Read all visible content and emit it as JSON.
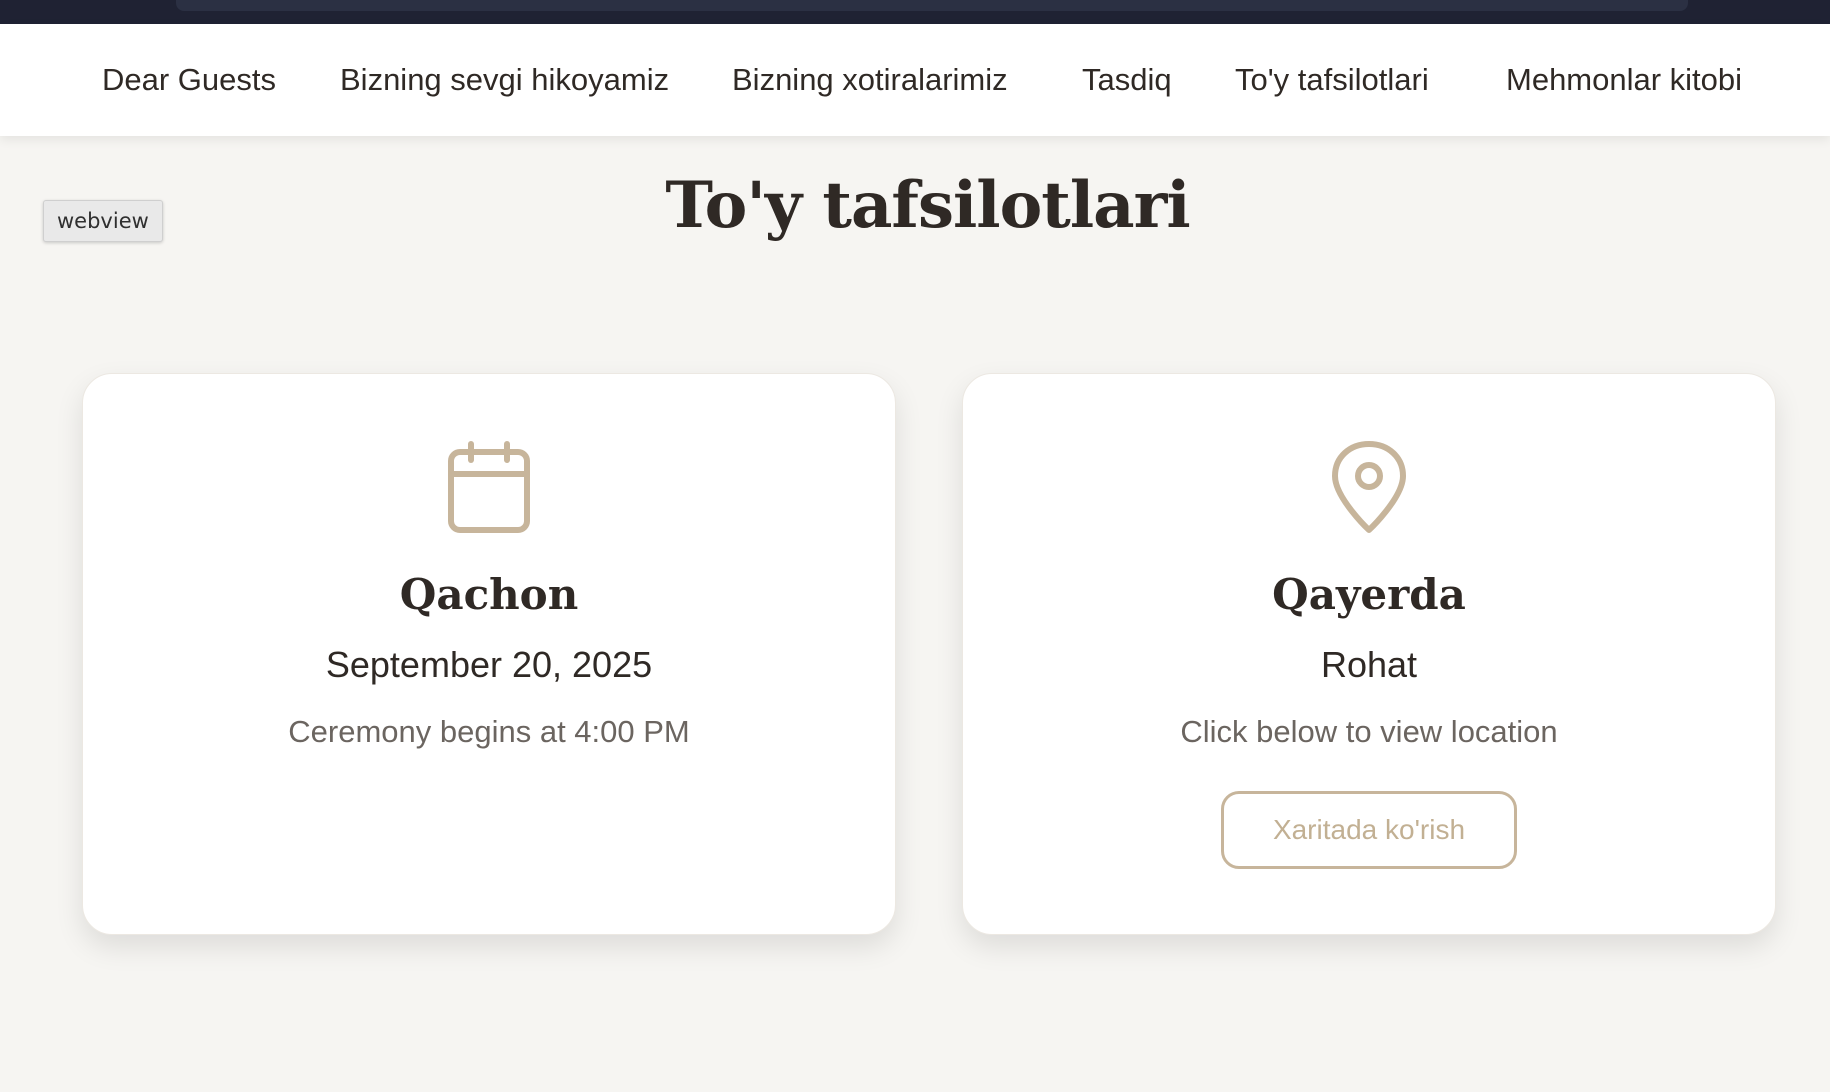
{
  "nav": {
    "items": [
      {
        "label": "Dear Guests"
      },
      {
        "label": "Bizning sevgi hikoyamiz"
      },
      {
        "label": "Bizning xotiralarimiz"
      },
      {
        "label": "Tasdiq"
      },
      {
        "label": "To'y tafsilotlari"
      },
      {
        "label": "Mehmonlar kitobi"
      }
    ]
  },
  "badge": {
    "label": "webview"
  },
  "page": {
    "title": "To'y tafsilotlari"
  },
  "cards": {
    "when": {
      "icon": "calendar-icon",
      "title": "Qachon",
      "main": "September 20, 2025",
      "sub": "Ceremony begins at 4:00 PM"
    },
    "where": {
      "icon": "location-pin-icon",
      "title": "Qayerda",
      "main": "Rohat",
      "sub": "Click below to view location",
      "button_label": "Xaritada ko'rish"
    }
  },
  "colors": {
    "page_background": "#f6f5f2",
    "accent": "#c7b59b",
    "text_dark": "#2f2925",
    "text_muted": "#6b6560",
    "top_strip": "#1f2233"
  }
}
